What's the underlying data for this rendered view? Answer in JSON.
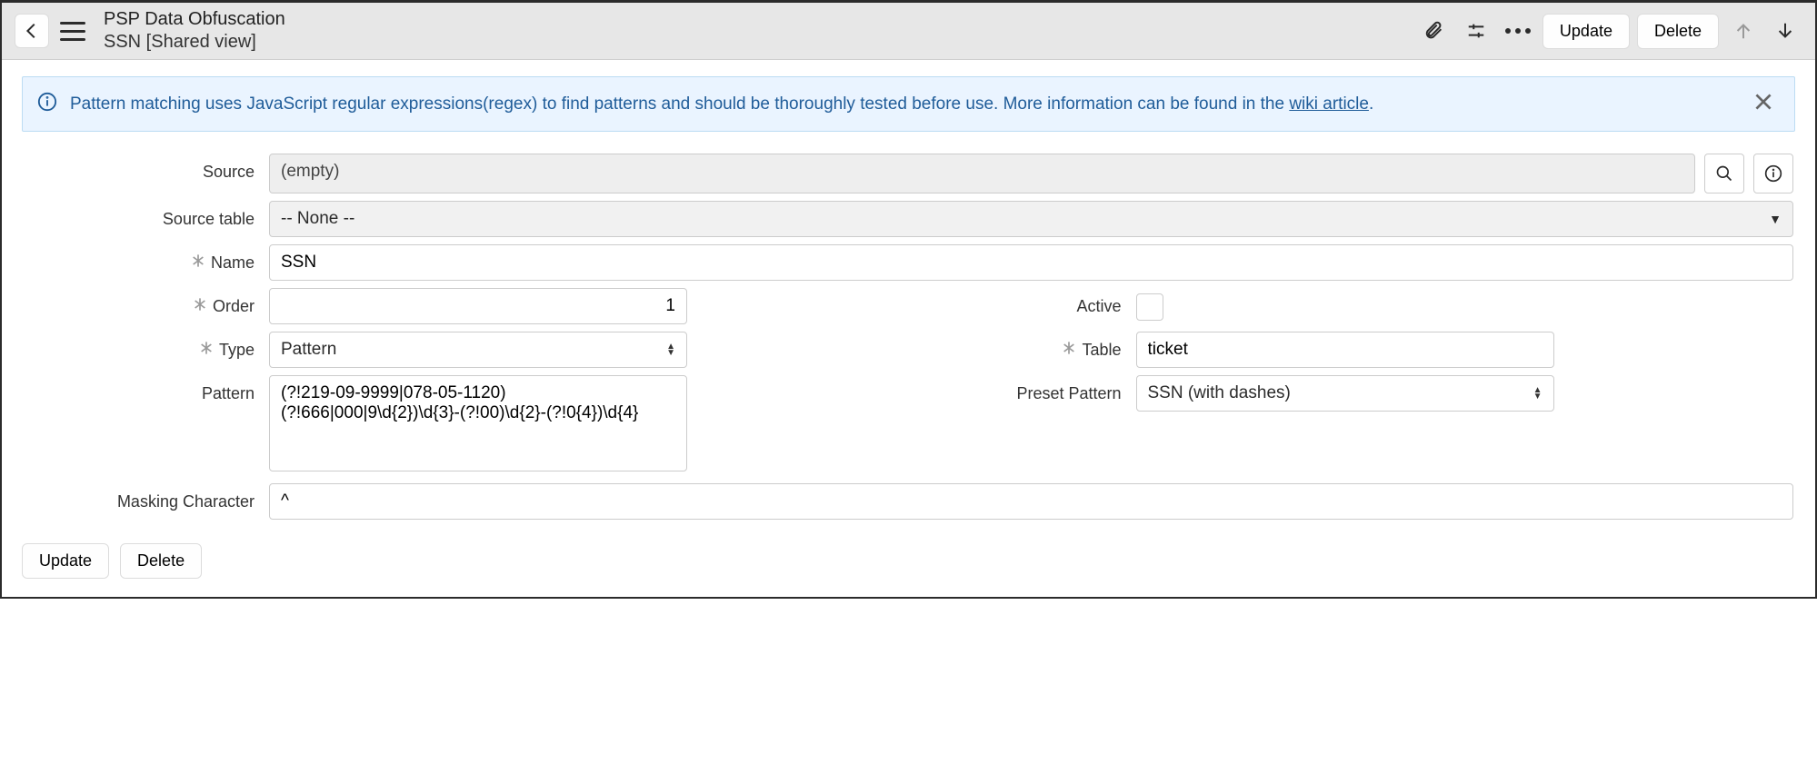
{
  "header": {
    "title_main": "PSP Data Obfuscation",
    "title_sub": "SSN [Shared view]",
    "update_label": "Update",
    "delete_label": "Delete"
  },
  "info": {
    "text_before_link": "Pattern matching uses JavaScript regular expressions(regex) to find patterns and should be thoroughly tested before use. More information can be found in the ",
    "link_text": "wiki article",
    "text_after_link": "."
  },
  "form": {
    "source": {
      "label": "Source",
      "value": "(empty)"
    },
    "source_table": {
      "label": "Source table",
      "value": "-- None --"
    },
    "name": {
      "label": "Name",
      "value": "SSN"
    },
    "order": {
      "label": "Order",
      "value": "1"
    },
    "active": {
      "label": "Active",
      "checked": false
    },
    "type": {
      "label": "Type",
      "value": "Pattern"
    },
    "table": {
      "label": "Table",
      "value": "ticket"
    },
    "pattern": {
      "label": "Pattern",
      "value": "(?!219-09-9999|078-05-1120)(?!666|000|9\\d{2})\\d{3}-(?!00)\\d{2}-(?!0{4})\\d{4}"
    },
    "preset_pattern": {
      "label": "Preset Pattern",
      "value": "SSN (with dashes)"
    },
    "masking_char": {
      "label": "Masking Character",
      "value": "^"
    }
  },
  "footer": {
    "update_label": "Update",
    "delete_label": "Delete"
  }
}
